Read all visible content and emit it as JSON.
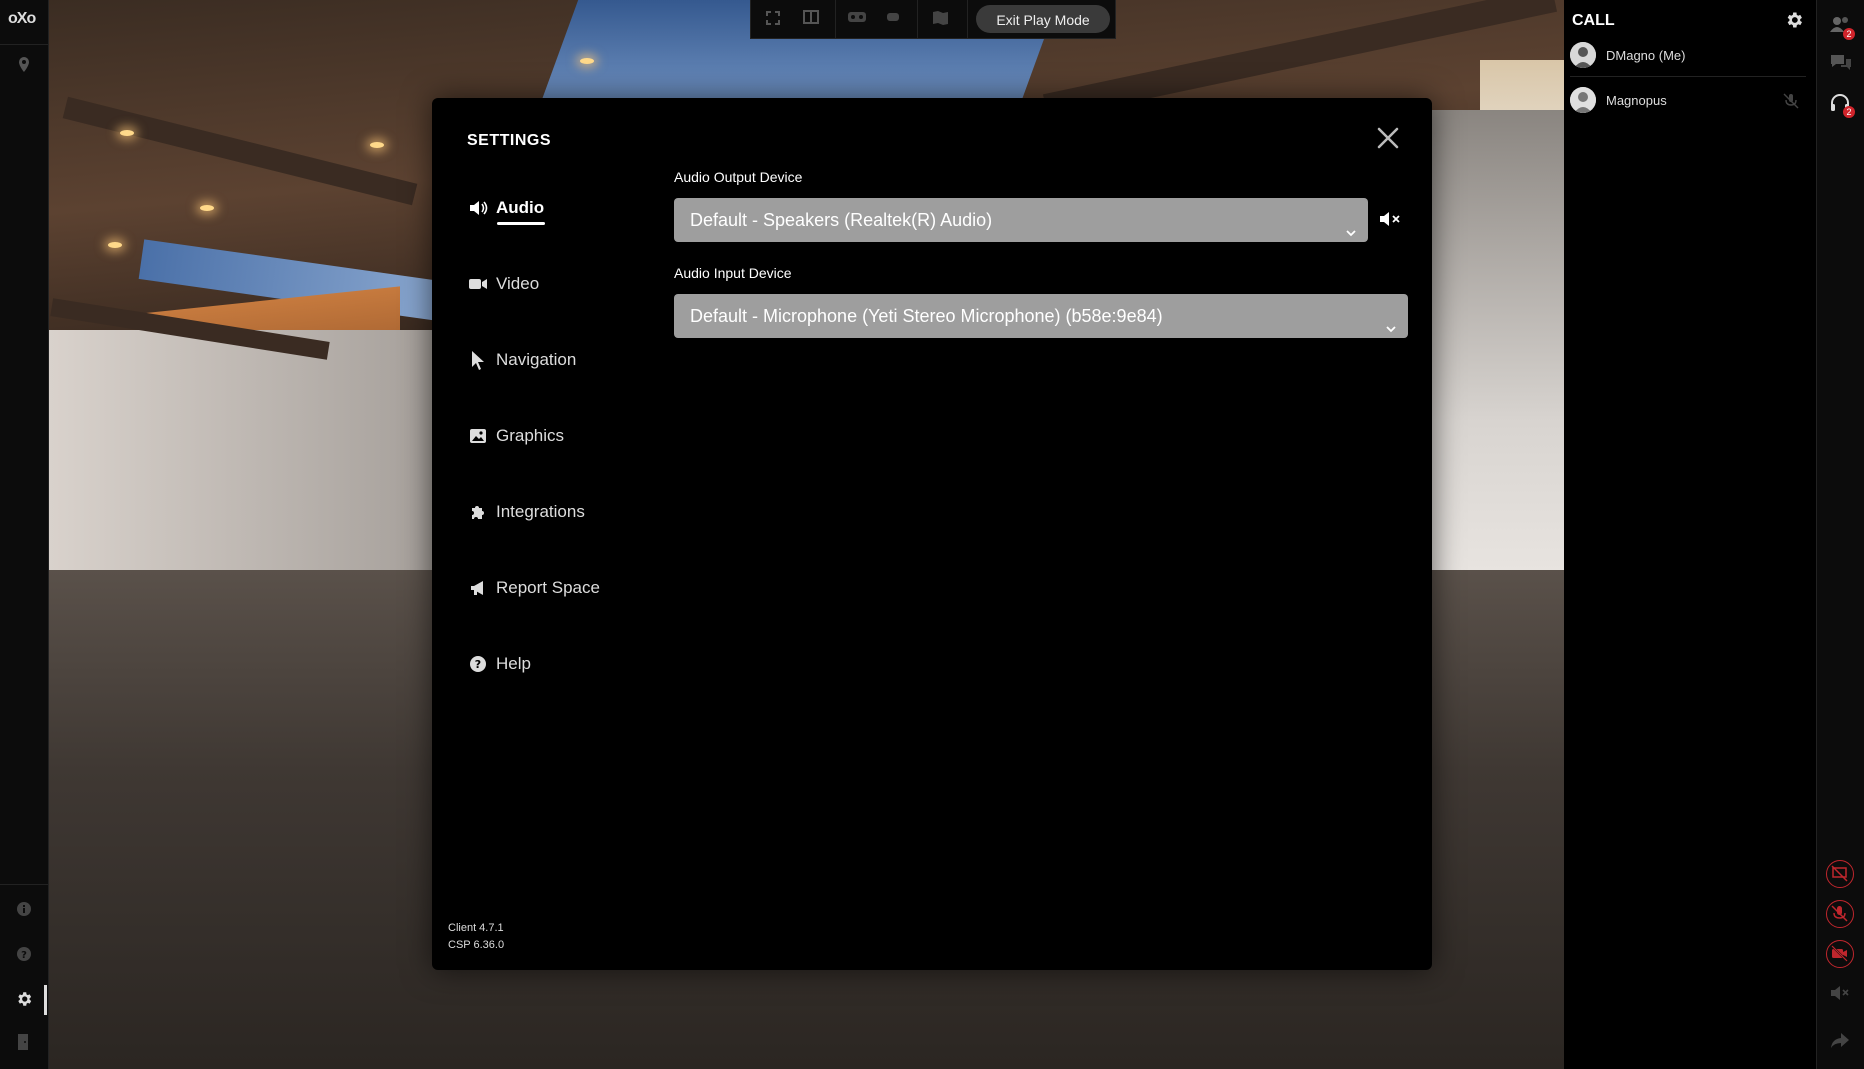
{
  "app": {
    "logo_text": "oXo"
  },
  "toolbar": {
    "exit_play_mode_label": "Exit Play Mode"
  },
  "settings": {
    "title": "SETTINGS",
    "nav": [
      {
        "label": "Audio",
        "icon": "speaker-icon",
        "active": true
      },
      {
        "label": "Video",
        "icon": "video-camera-icon",
        "active": false
      },
      {
        "label": "Navigation",
        "icon": "cursor-arrow-icon",
        "active": false
      },
      {
        "label": "Graphics",
        "icon": "image-icon",
        "active": false
      },
      {
        "label": "Integrations",
        "icon": "puzzle-icon",
        "active": false
      },
      {
        "label": "Report Space",
        "icon": "megaphone-icon",
        "active": false
      },
      {
        "label": "Help",
        "icon": "question-circle-icon",
        "active": false
      }
    ],
    "audio": {
      "output_label": "Audio Output Device",
      "output_value": "Default - Speakers (Realtek(R) Audio)",
      "input_label": "Audio Input Device",
      "input_value": "Default - Microphone (Yeti Stereo Microphone) (b58e:9e84)"
    },
    "version": {
      "client": "Client 4.7.1",
      "csp": "CSP 6.36.0"
    }
  },
  "call": {
    "title": "CALL",
    "participants": [
      {
        "name": "DMagno (Me)",
        "muted": false
      },
      {
        "name": "Magnopus",
        "muted": true
      }
    ]
  },
  "rightrail": {
    "people_badge": "2",
    "headset_badge": "2"
  },
  "colors": {
    "modal_bg": "#000000",
    "select_bg": "#9e9e9e",
    "alert_red": "#c0262d",
    "badge_red": "#d0242b"
  }
}
